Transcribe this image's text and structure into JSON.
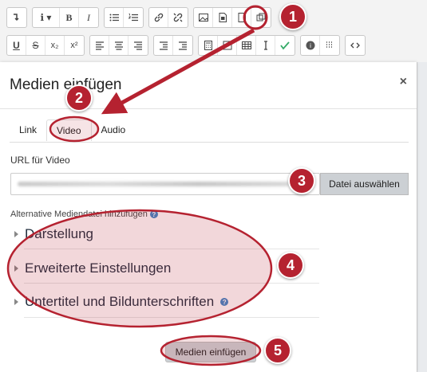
{
  "toolbar": {
    "row1_groups": [
      [
        "paragraph-icon"
      ],
      [
        "info-icon",
        "bold-icon",
        "italic-icon"
      ],
      [
        "bullet-list-icon",
        "numbered-list-icon"
      ],
      [
        "link-icon",
        "unlink-icon"
      ],
      [
        "image-icon",
        "media-icon",
        "manage-files-icon",
        "copy-icon"
      ]
    ],
    "row1_labels": {
      "bold": "B",
      "italic": "I"
    },
    "row2_labels": {
      "underline": "U",
      "strike": "S",
      "sub": "x₂",
      "sup": "x²"
    }
  },
  "modal": {
    "title": "Medien einfügen",
    "close": "×",
    "tabs": [
      {
        "label": "Link",
        "active": false
      },
      {
        "label": "Video",
        "active": true
      },
      {
        "label": "Audio",
        "active": false
      }
    ],
    "url_label": "URL für Video",
    "choose_button": "Datei auswählen",
    "alt_label": "Alternative Mediendatei hinzufügen",
    "help": "?",
    "sections": [
      {
        "label": "Darstellung"
      },
      {
        "label": "Erweiterte Einstellungen"
      },
      {
        "label": "Untertitel und Bildunterschriften"
      }
    ],
    "submit_button": "Medien einfügen"
  },
  "annotations": {
    "color": "#b52230",
    "badges": [
      "1",
      "2",
      "3",
      "4",
      "5"
    ]
  }
}
